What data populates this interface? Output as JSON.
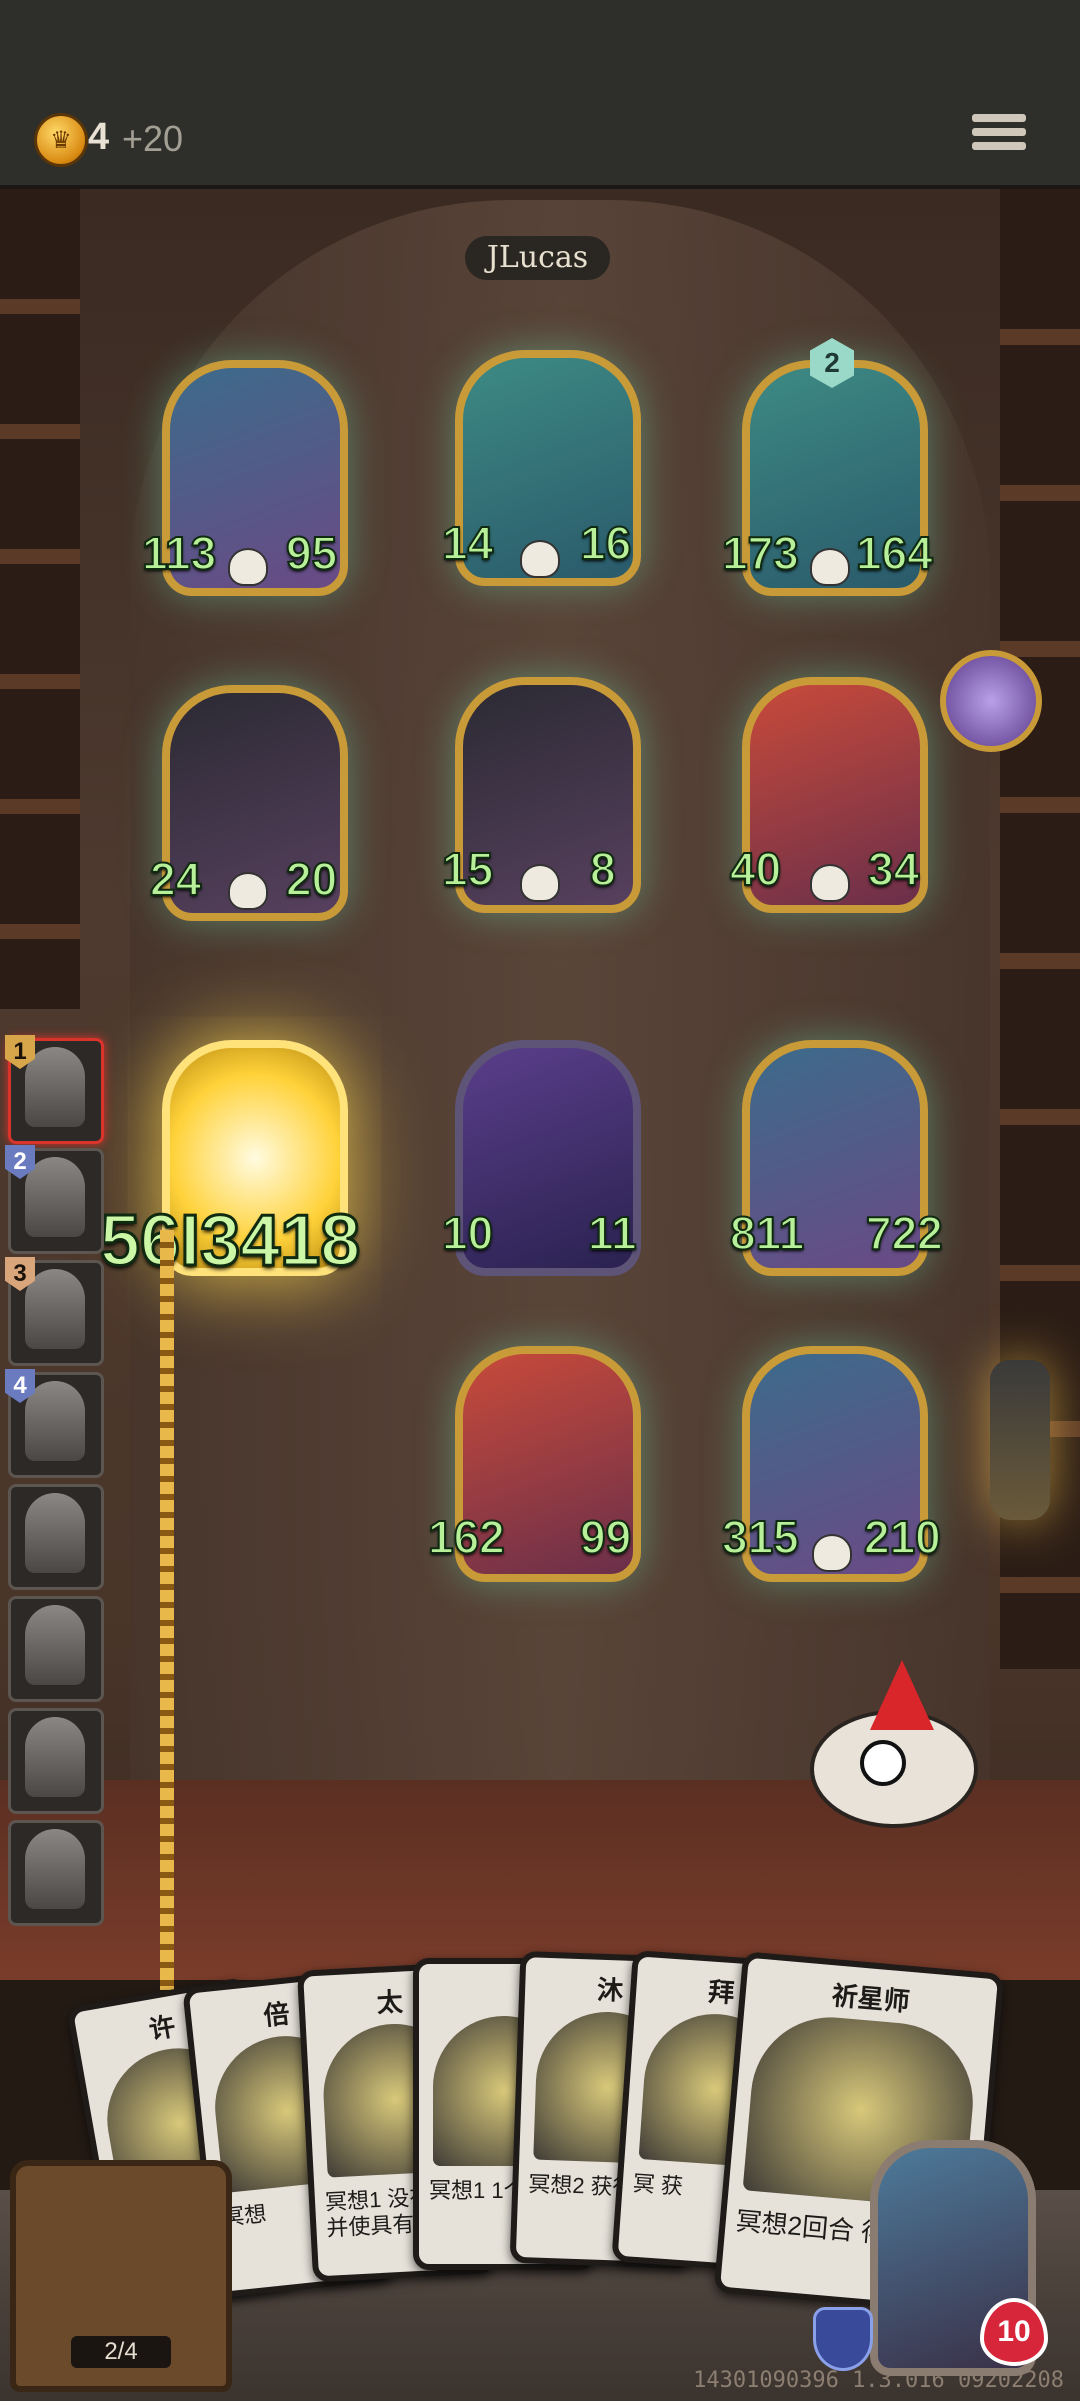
{
  "header": {
    "gold": "4",
    "gold_bonus": "+20"
  },
  "opponent": {
    "name": "JLucas"
  },
  "board": {
    "row1": [
      {
        "attack": "113",
        "health": "95"
      },
      {
        "attack": "14",
        "health": "16"
      },
      {
        "attack": "173",
        "health": "164",
        "tier": "2"
      }
    ],
    "row2": [
      {
        "attack": "24",
        "health": "20"
      },
      {
        "attack": "15",
        "health": "8"
      },
      {
        "attack": "40",
        "health": "34"
      }
    ],
    "row3": [
      {
        "combined": "56I3418"
      },
      {
        "attack": "10",
        "health": "11"
      },
      {
        "attack": "811",
        "health": "722"
      }
    ],
    "row4": [
      {
        "attack": "162",
        "health": "99"
      },
      {
        "attack": "315",
        "health": "210"
      }
    ]
  },
  "sidebar": {
    "slots": [
      {
        "num": "1"
      },
      {
        "num": "2"
      },
      {
        "num": "3"
      },
      {
        "num": "4"
      },
      {
        "num": ""
      },
      {
        "num": ""
      },
      {
        "num": ""
      },
      {
        "num": ""
      }
    ]
  },
  "hand": {
    "cards": [
      {
        "title": "许",
        "desc": ""
      },
      {
        "title": "倍",
        "desc": "冥想"
      },
      {
        "title": "太",
        "desc": "冥想1 没有护 并使具有"
      },
      {
        "title": "",
        "desc": "冥想1 1个开"
      },
      {
        "title": "沐",
        "desc": "冥想2 获得+"
      },
      {
        "title": "拜",
        "desc": "冥 获"
      },
      {
        "title": "祈星师",
        "desc": "冥想2回合 得1?"
      }
    ]
  },
  "player": {
    "hp": "10",
    "deck_counter": "2/4"
  },
  "footer": {
    "version": "14301090396 1.3.016 09202208"
  }
}
